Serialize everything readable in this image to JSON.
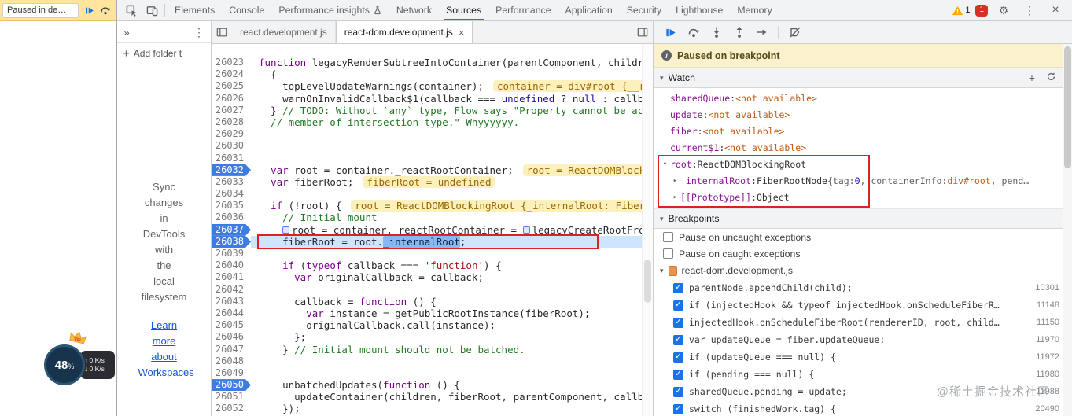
{
  "icons": {
    "gear": "⚙",
    "kebab": "⋮",
    "close": "×",
    "close_tab": "×",
    "chevrons": "»",
    "plus": "+",
    "collapse": "▾",
    "expand": "▸",
    "check": "✓",
    "up": "↑",
    "down": "↓",
    "info": "i"
  },
  "page": {
    "paused_label": "Paused in de…",
    "speed_widget": {
      "percent": "48",
      "unit": "%",
      "up": "0 K/s",
      "down": "0 K/s",
      "vip": "VIP"
    }
  },
  "devtools": {
    "top_tabs": [
      {
        "label": "Elements"
      },
      {
        "label": "Console"
      },
      {
        "label": "Performance insights",
        "flask": true
      },
      {
        "label": "Network"
      },
      {
        "label": "Sources",
        "active": true
      },
      {
        "label": "Performance"
      },
      {
        "label": "Application"
      },
      {
        "label": "Security"
      },
      {
        "label": "Lighthouse"
      },
      {
        "label": "Memory"
      }
    ],
    "badges": {
      "warnings": "1",
      "errors": "1"
    }
  },
  "navigator": {
    "add_folder": "Add folder t",
    "hint": "Sync changes in DevTools with the local filesystem",
    "link": "Learn more about Workspaces"
  },
  "editor": {
    "tabs": [
      {
        "label": "react.development.js"
      },
      {
        "label": "react-dom.development.js",
        "active": true
      }
    ],
    "lines": [
      {
        "num": "26023",
        "segs": [
          [
            "k",
            "function"
          ],
          [
            "d",
            " legacyRenderSubtreeIntoContainer(parentComponent, childre"
          ]
        ]
      },
      {
        "num": "26024",
        "segs": [
          [
            "d",
            "  {"
          ]
        ]
      },
      {
        "num": "26025",
        "segs": [
          [
            "d",
            "    topLevelUpdateWarnings(container);"
          ]
        ],
        "eval": "container = div#root {__re"
      },
      {
        "num": "26026",
        "segs": [
          [
            "d",
            "    warnOnInvalidCallback$1(callback === "
          ],
          [
            "n",
            "undefined"
          ],
          [
            "d",
            " ? "
          ],
          [
            "n",
            "null"
          ],
          [
            "d",
            " : callba"
          ]
        ]
      },
      {
        "num": "26027",
        "segs": [
          [
            "d",
            "  } "
          ],
          [
            "c",
            "// TODO: Without `any` type, Flow says \"Property cannot be acc"
          ]
        ]
      },
      {
        "num": "26028",
        "segs": [
          [
            "c",
            "  // member of intersection type.\" Whyyyyyy."
          ]
        ]
      },
      {
        "num": "26029",
        "segs": []
      },
      {
        "num": "26030",
        "segs": []
      },
      {
        "num": "26031",
        "segs": []
      },
      {
        "num": "26032",
        "bp": true,
        "segs": [
          [
            "d",
            "  "
          ],
          [
            "k",
            "var"
          ],
          [
            "d",
            " root = container._reactRootContainer;"
          ]
        ],
        "eval": "root = ReactDOMBlocki"
      },
      {
        "num": "26033",
        "segs": [
          [
            "d",
            "  "
          ],
          [
            "k",
            "var"
          ],
          [
            "d",
            " fiberRoot;"
          ]
        ],
        "eval": "fiberRoot = undefined"
      },
      {
        "num": "26034",
        "segs": []
      },
      {
        "num": "26035",
        "segs": [
          [
            "d",
            "  "
          ],
          [
            "k",
            "if"
          ],
          [
            "d",
            " (!root) {"
          ]
        ],
        "eval": "root = ReactDOMBlockingRoot {_internalRoot: FiberR"
      },
      {
        "num": "26036",
        "segs": [
          [
            "c",
            "    // Initial mount"
          ]
        ]
      },
      {
        "num": "26037",
        "bp": true,
        "segs": [
          [
            "d",
            "    "
          ],
          [
            "m",
            ""
          ],
          [
            "d",
            "root = container._reactRootContainer = "
          ],
          [
            "m",
            ""
          ],
          [
            "d",
            "legacyCreateRootFrom"
          ]
        ]
      },
      {
        "num": "26038",
        "bp": true,
        "cur": true,
        "segs": [
          [
            "d",
            "    fiberRoot = root."
          ],
          [
            "sel",
            "_internalRoot"
          ],
          [
            "d",
            ";"
          ]
        ]
      },
      {
        "num": "26039",
        "segs": []
      },
      {
        "num": "26040",
        "segs": [
          [
            "d",
            "    "
          ],
          [
            "k",
            "if"
          ],
          [
            "d",
            " ("
          ],
          [
            "k",
            "typeof"
          ],
          [
            "d",
            " callback === "
          ],
          [
            "s",
            "'function'"
          ],
          [
            "d",
            ") {"
          ]
        ]
      },
      {
        "num": "26041",
        "segs": [
          [
            "d",
            "      "
          ],
          [
            "k",
            "var"
          ],
          [
            "d",
            " originalCallback = callback;"
          ]
        ]
      },
      {
        "num": "26042",
        "segs": []
      },
      {
        "num": "26043",
        "segs": [
          [
            "d",
            "      callback = "
          ],
          [
            "k",
            "function"
          ],
          [
            "d",
            " () {"
          ]
        ]
      },
      {
        "num": "26044",
        "segs": [
          [
            "d",
            "        "
          ],
          [
            "k",
            "var"
          ],
          [
            "d",
            " instance = getPublicRootInstance(fiberRoot);"
          ]
        ]
      },
      {
        "num": "26045",
        "segs": [
          [
            "d",
            "        originalCallback.call(instance);"
          ]
        ]
      },
      {
        "num": "26046",
        "segs": [
          [
            "d",
            "      };"
          ]
        ]
      },
      {
        "num": "26047",
        "segs": [
          [
            "d",
            "    } "
          ],
          [
            "c",
            "// Initial mount should not be batched."
          ]
        ]
      },
      {
        "num": "26048",
        "segs": []
      },
      {
        "num": "26049",
        "segs": []
      },
      {
        "num": "26050",
        "bp": true,
        "segs": [
          [
            "d",
            "    unbatchedUpdates("
          ],
          [
            "k",
            "function"
          ],
          [
            "d",
            " () {"
          ]
        ]
      },
      {
        "num": "26051",
        "segs": [
          [
            "d",
            "      updateContainer(children, fiberRoot, parentComponent, callba"
          ]
        ]
      },
      {
        "num": "26052",
        "segs": [
          [
            "d",
            "    });"
          ]
        ]
      }
    ]
  },
  "debugger": {
    "paused_message": "Paused on breakpoint",
    "watch": {
      "title": "Watch",
      "items": [
        {
          "name": "sharedQueue",
          "parts": [
            [
              "na",
              "<not available>"
            ]
          ]
        },
        {
          "name": "update",
          "parts": [
            [
              "na",
              "<not available>"
            ]
          ]
        },
        {
          "name": "fiber",
          "parts": [
            [
              "na",
              "<not available>"
            ]
          ]
        },
        {
          "name": "current$1",
          "parts": [
            [
              "na",
              "<not available>"
            ]
          ]
        },
        {
          "name": "root",
          "arrow": "▾",
          "parts": [
            [
              "obj",
              "ReactDOMBlockingRoot"
            ]
          ]
        },
        {
          "name": "_internalRoot",
          "arrow": "▸",
          "indent": 1,
          "parts": [
            [
              "obj",
              "FiberRootNode "
            ],
            [
              "gray",
              "{tag: "
            ],
            [
              "num",
              "0"
            ],
            [
              "gray",
              ", containerInfo: "
            ],
            [
              "el",
              "div#root"
            ],
            [
              "gray",
              ", pend…"
            ]
          ]
        },
        {
          "name": "[[Prototype]]",
          "arrow": "▸",
          "indent": 1,
          "parts": [
            [
              "obj",
              "Object"
            ]
          ]
        }
      ]
    },
    "breakpoints": {
      "title": "Breakpoints",
      "exceptions": [
        "Pause on uncaught exceptions",
        "Pause on caught exceptions"
      ],
      "file": "react-dom.development.js",
      "entries": [
        {
          "code": "parentNode.appendChild(child);",
          "line": "10301"
        },
        {
          "code": "if (injectedHook && typeof injectedHook.onScheduleFiberR…",
          "line": "11148"
        },
        {
          "code": "injectedHook.onScheduleFiberRoot(rendererID, root, child…",
          "line": "11150"
        },
        {
          "code": "var updateQueue = fiber.updateQueue;",
          "line": "11970"
        },
        {
          "code": "if (updateQueue === null) {",
          "line": "11972"
        },
        {
          "code": "if (pending === null) {",
          "line": "11980"
        },
        {
          "code": "sharedQueue.pending = update;",
          "line": "11988"
        },
        {
          "code": "switch (finishedWork.tag) {",
          "line": "20490"
        }
      ]
    }
  },
  "watermark": "@稀土掘金技术社区"
}
